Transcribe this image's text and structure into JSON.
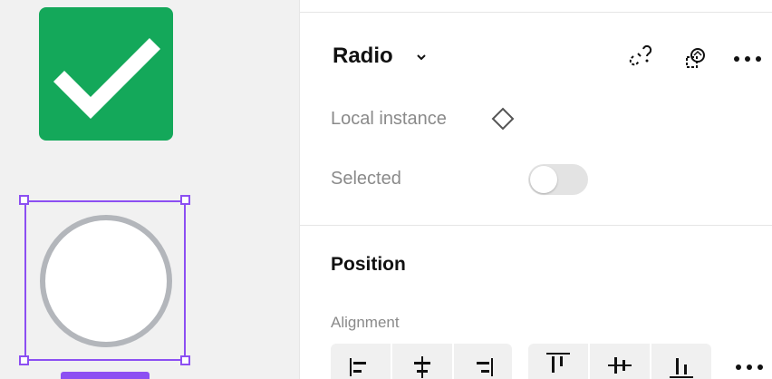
{
  "canvas": {
    "colors": {
      "background": "#f1f1f1",
      "checkbox_fill": "#14a85a",
      "selection": "#8c4ff2",
      "radio_ring": "#b3b6bb"
    }
  },
  "panel": {
    "component_title": "Radio",
    "title_chevron_icon": "chevron-down-icon",
    "header_actions": [
      {
        "name": "detach-instance-icon"
      },
      {
        "name": "swap-instance-icon"
      },
      {
        "name": "more-icon"
      }
    ],
    "local_instance_label": "Local instance",
    "local_instance_icon": "diamond-icon",
    "selected_property": {
      "label": "Selected",
      "toggle_on": false
    },
    "position_section": {
      "title": "Position",
      "alignment_label": "Alignment",
      "horizontal_align_buttons": [
        "align-left-icon",
        "align-horizontal-center-icon",
        "align-right-icon"
      ],
      "vertical_align_buttons": [
        "align-top-icon",
        "align-vertical-center-icon",
        "align-bottom-icon"
      ],
      "more_icon": "more-icon"
    }
  }
}
